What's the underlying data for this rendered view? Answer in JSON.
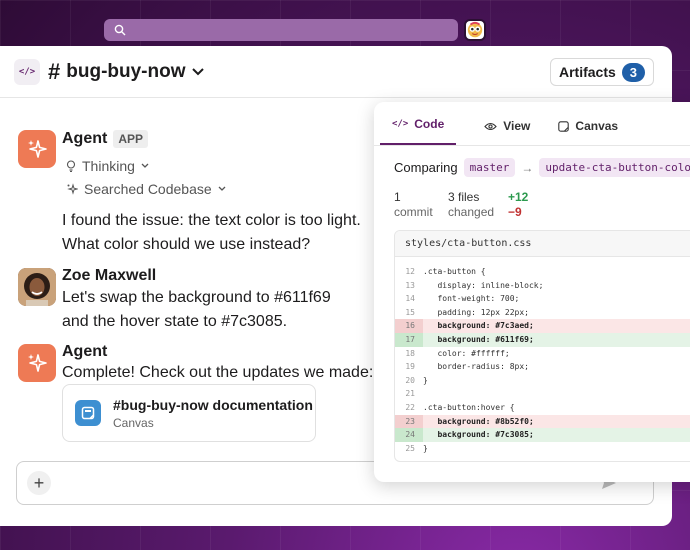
{
  "top_bar": {
    "search_icon": "search-icon",
    "app_icon": "slack-app-icon"
  },
  "header": {
    "channel_prefix_icon": "code-icon",
    "channel_prefix_text": "</>",
    "hash": "#",
    "channel_name": "bug-buy-now",
    "chevron": "⌄",
    "artifacts_label": "Artifacts",
    "artifacts_count": "3"
  },
  "messages": [
    {
      "sender": "Agent",
      "tag": "APP",
      "thinking_label": "Thinking",
      "searched_label": "Searched Codebase",
      "lines": [
        "I found the issue: the text color is too light.",
        "What color should we use instead?"
      ]
    },
    {
      "sender": "Zoe Maxwell",
      "lines": [
        "Let's swap the background to #611f69",
        "and the hover state to #7c3085."
      ]
    },
    {
      "sender": "Agent",
      "lines": [
        "Complete! Check out the updates we made:"
      ],
      "attachment": {
        "title": "#bug-buy-now documentation",
        "subtitle": "Canvas"
      }
    }
  ],
  "composer": {
    "plus": "+"
  },
  "panel": {
    "tabs": [
      {
        "label": "Code",
        "icon": "code-icon"
      },
      {
        "label": "View",
        "icon": "eye-icon"
      },
      {
        "label": "Canvas",
        "icon": "canvas-icon"
      }
    ],
    "compare_label": "Comparing",
    "base_branch": "master",
    "arrow": "→",
    "head_branch": "update-cta-button-color",
    "commits_count": "1",
    "commits_label": "commit",
    "files_count": "3 files",
    "files_label": "changed",
    "additions": "+12",
    "deletions": "−9",
    "file_name": "styles/cta-button.css",
    "code": [
      {
        "n": "12",
        "t": ".cta-button {",
        "s": ""
      },
      {
        "n": "13",
        "t": "   display: inline-block;",
        "s": ""
      },
      {
        "n": "14",
        "t": "   font-weight: 700;",
        "s": ""
      },
      {
        "n": "15",
        "t": "   padding: 12px 22px;",
        "s": ""
      },
      {
        "n": "16",
        "t": "   background: #7c3aed;",
        "s": "minus"
      },
      {
        "n": "17",
        "t": "   background: #611f69;",
        "s": "plus"
      },
      {
        "n": "18",
        "t": "   color: #ffffff;",
        "s": ""
      },
      {
        "n": "19",
        "t": "   border-radius: 8px;",
        "s": ""
      },
      {
        "n": "20",
        "t": "}",
        "s": ""
      },
      {
        "n": "21",
        "t": "",
        "s": ""
      },
      {
        "n": "22",
        "t": ".cta-button:hover {",
        "s": ""
      },
      {
        "n": "23",
        "t": "   background: #8b52f0;",
        "s": "minus"
      },
      {
        "n": "24",
        "t": "   background: #7c3085;",
        "s": "plus"
      },
      {
        "n": "25",
        "t": "}",
        "s": ""
      }
    ]
  },
  "colors": {
    "accent": "#611f69",
    "agent_avatar": "#ee7a55",
    "badge": "#1f5fa8"
  }
}
